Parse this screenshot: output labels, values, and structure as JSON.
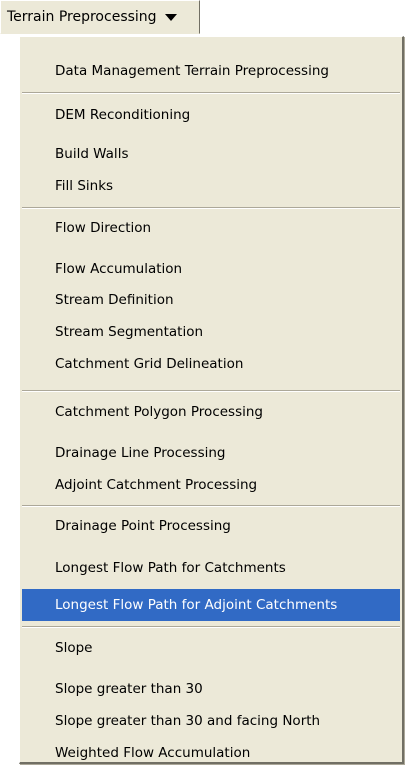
{
  "menubar": {
    "label": "Terrain Preprocessing",
    "caret_icon": "triangle-down"
  },
  "menu": {
    "highlight_color": "#316ac5",
    "background_color": "#ece9d8",
    "items": [
      {
        "label": "Data Management Terrain Preprocessing",
        "highlighted": false
      },
      {
        "label": "DEM Reconditioning",
        "highlighted": false
      },
      {
        "label": "Build Walls",
        "highlighted": false
      },
      {
        "label": "Fill Sinks",
        "highlighted": false
      },
      {
        "label": "Flow Direction",
        "highlighted": false
      },
      {
        "label": "Flow Accumulation",
        "highlighted": false
      },
      {
        "label": "Stream Definition",
        "highlighted": false
      },
      {
        "label": "Stream Segmentation",
        "highlighted": false
      },
      {
        "label": "Catchment Grid Delineation",
        "highlighted": false
      },
      {
        "label": "Catchment Polygon Processing",
        "highlighted": false
      },
      {
        "label": "Drainage Line Processing",
        "highlighted": false
      },
      {
        "label": "Adjoint Catchment Processing",
        "highlighted": false
      },
      {
        "label": "Drainage Point Processing",
        "highlighted": false
      },
      {
        "label": "Longest Flow Path for Catchments",
        "highlighted": false
      },
      {
        "label": "Longest Flow Path for Adjoint Catchments",
        "highlighted": true
      },
      {
        "label": "Slope",
        "highlighted": false
      },
      {
        "label": "Slope greater than 30",
        "highlighted": false
      },
      {
        "label": "Slope greater than 30 and facing North",
        "highlighted": false
      },
      {
        "label": "Weighted Flow Accumulation",
        "highlighted": false
      }
    ]
  }
}
